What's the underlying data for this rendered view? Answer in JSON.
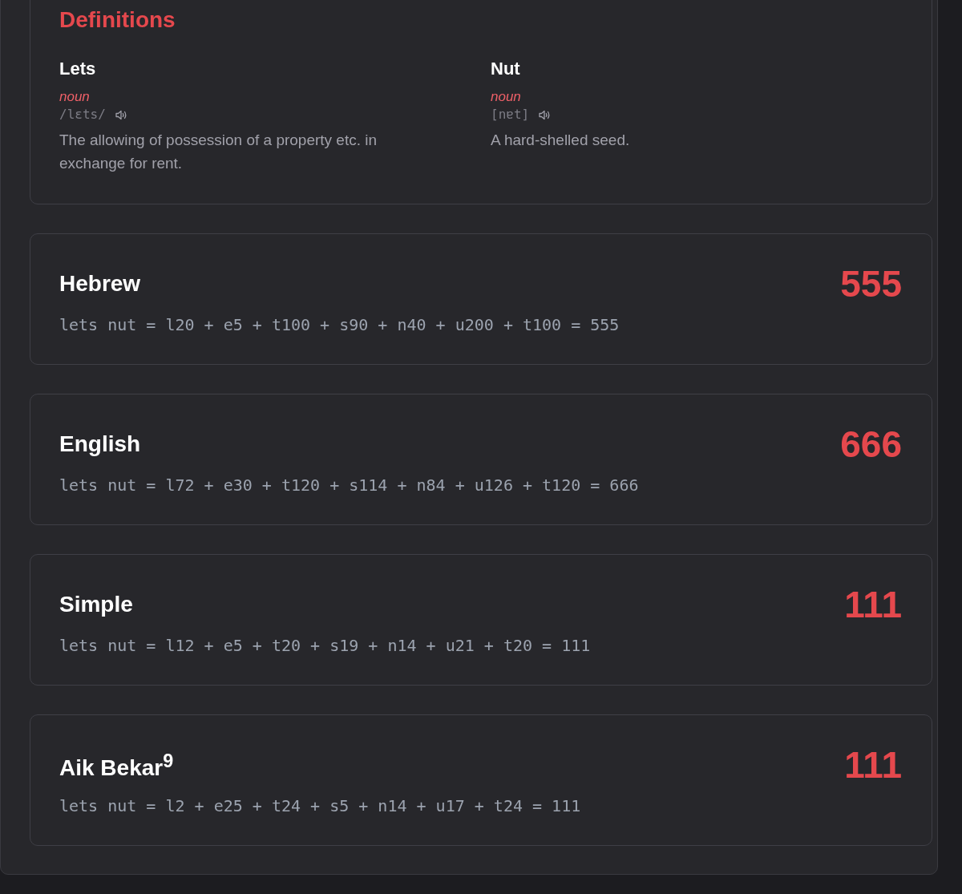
{
  "definitions": {
    "title": "Definitions",
    "entries": [
      {
        "word": "Lets",
        "part_of_speech": "noun",
        "pronunciation": "/lɛts/",
        "meaning": "The allowing of possession of a property etc. in exchange for rent."
      },
      {
        "word": "Nut",
        "part_of_speech": "noun",
        "pronunciation": "[nɐt]",
        "meaning": "A hard-shelled seed."
      }
    ]
  },
  "ciphers": [
    {
      "name": "Hebrew",
      "total": "555",
      "formula": "lets nut = l20 + e5 + t100 + s90 + n40 + u200 + t100 = 555"
    },
    {
      "name": "English",
      "total": "666",
      "formula": "lets nut = l72 + e30 + t120 + s114 + n84 + u126 + t120 = 666"
    },
    {
      "name": "Simple",
      "total": "111",
      "formula": "lets nut = l12 + e5 + t20 + s19 + n14 + u21 + t20 = 111"
    },
    {
      "name": "Aik Bekar$^{9}$",
      "total": "111",
      "formula": "lets nut = l2 + e25 + t24 + s5 + n14 + u17 + t24 = 111"
    }
  ]
}
